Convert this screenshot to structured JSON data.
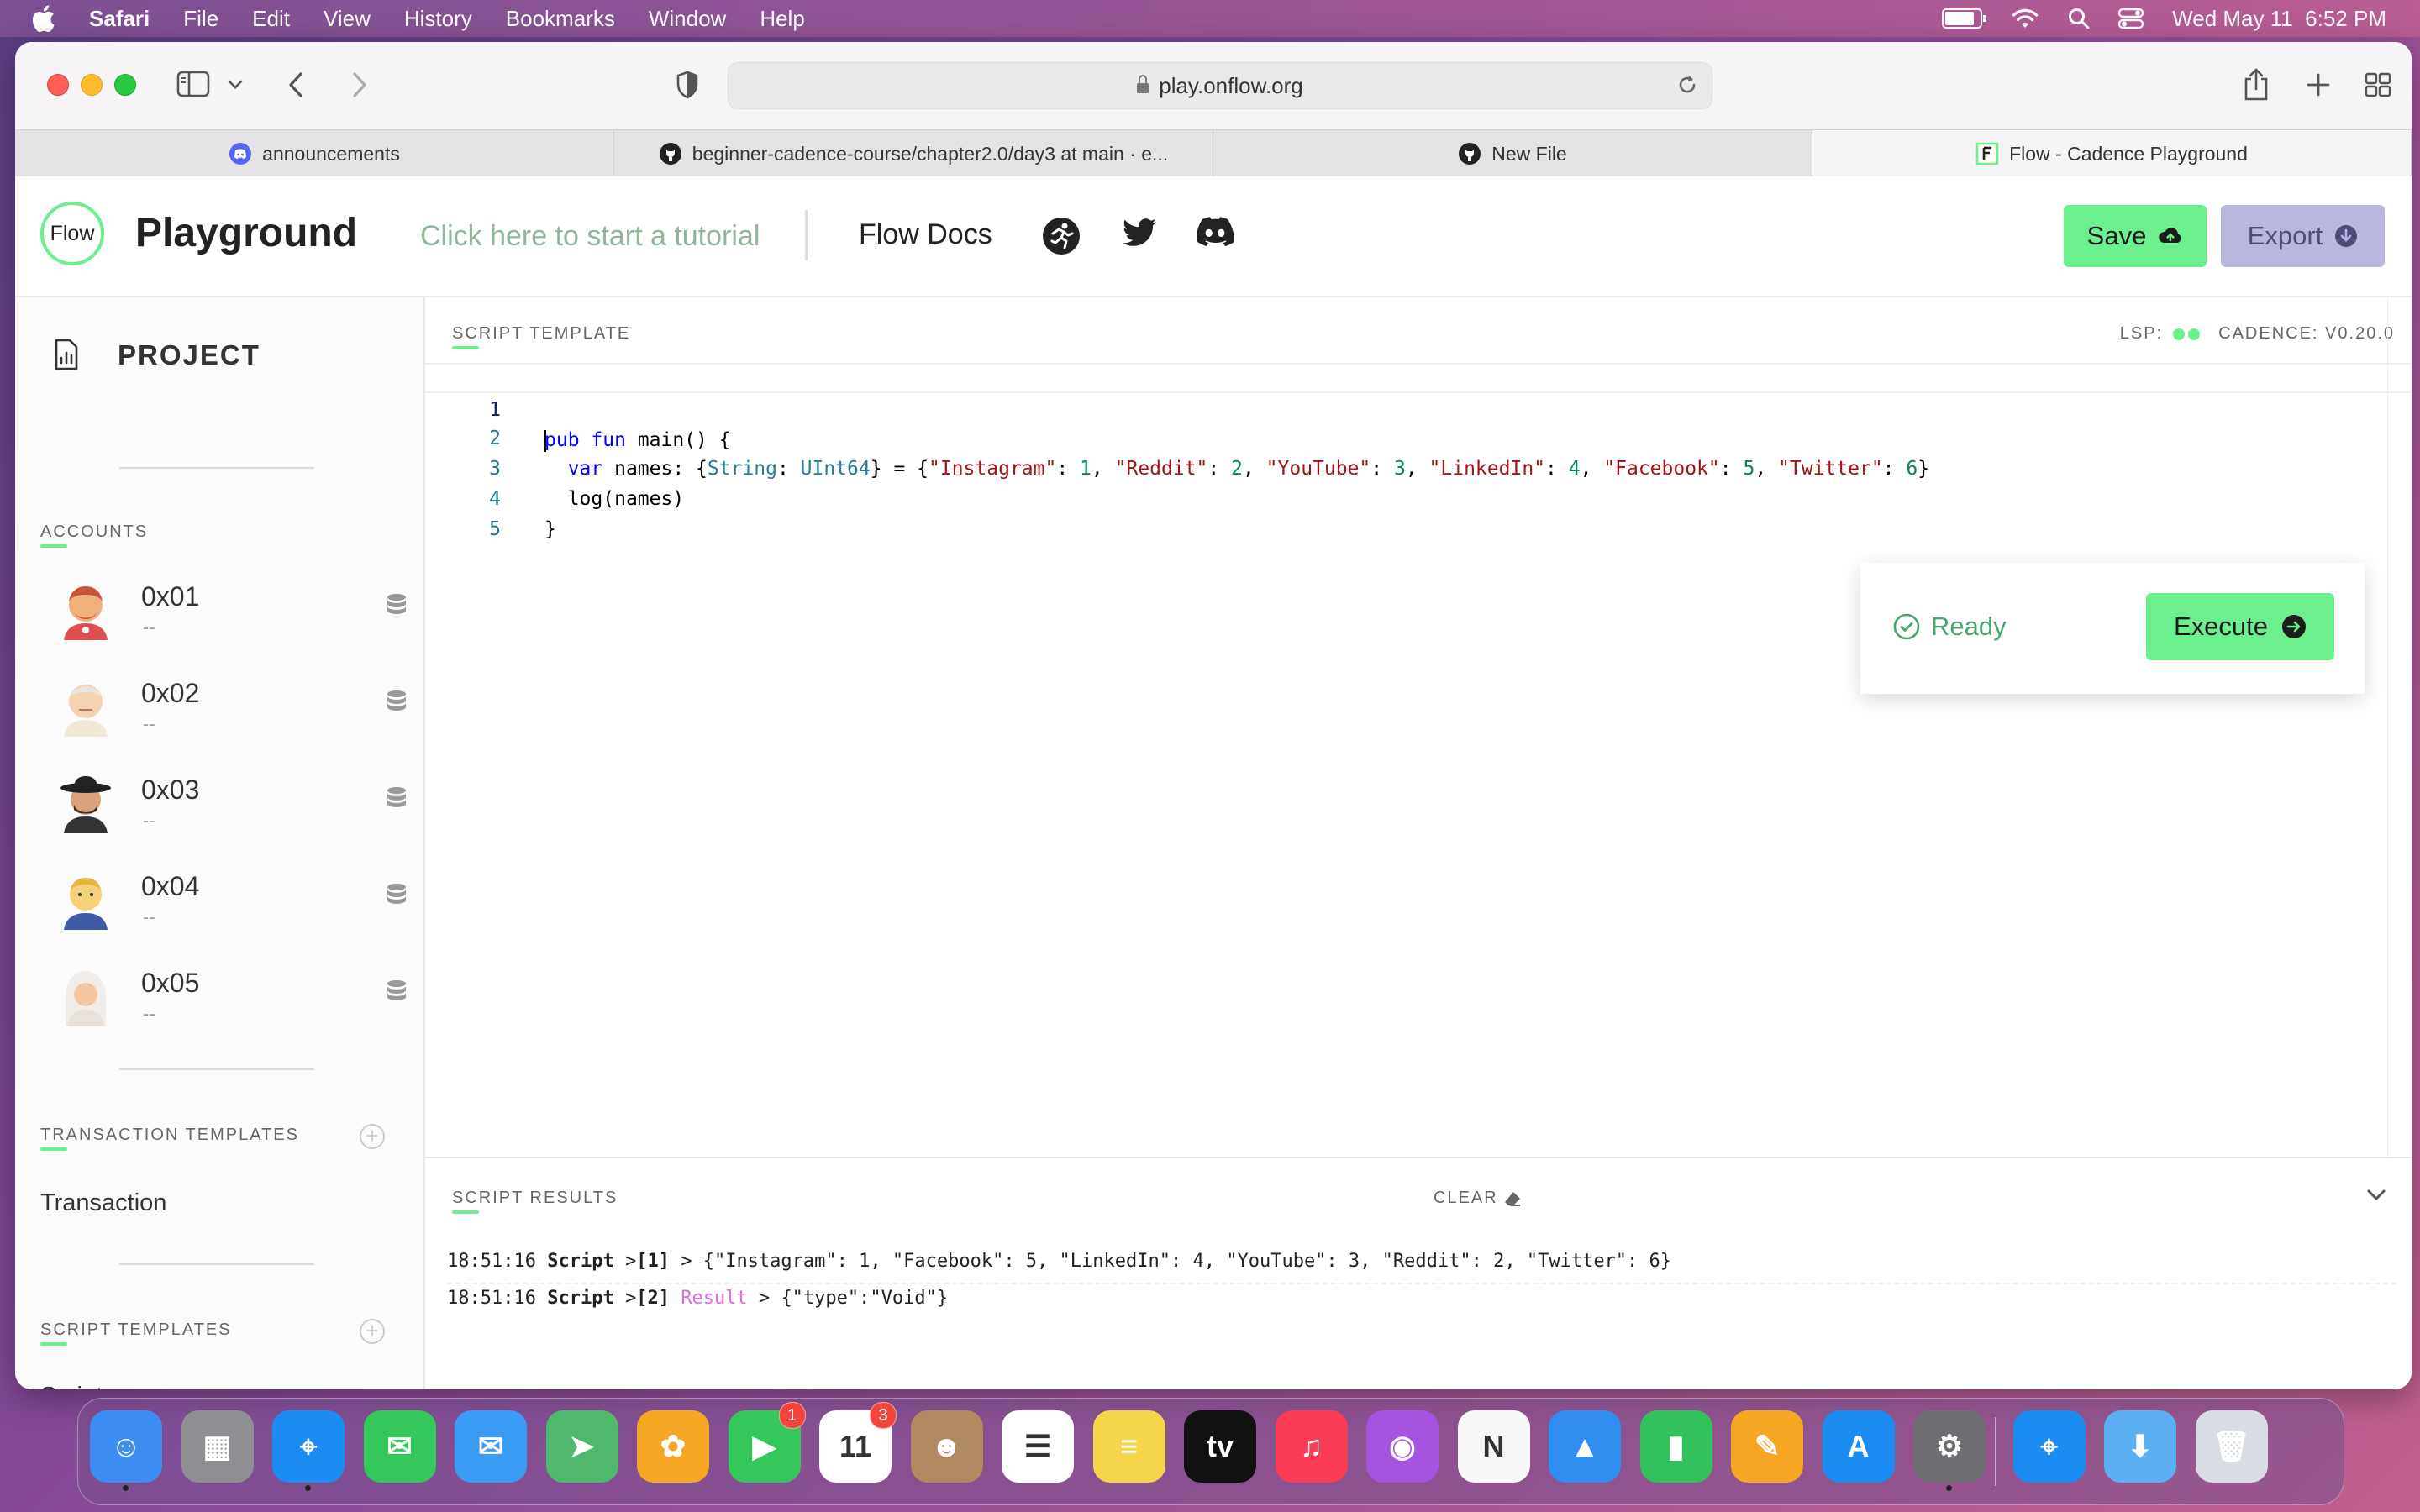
{
  "menubar": {
    "app_name": "Safari",
    "items": [
      "File",
      "Edit",
      "View",
      "History",
      "Bookmarks",
      "Window",
      "Help"
    ],
    "battery_level": 0.9,
    "datetime": "Wed May 11  6:52 PM"
  },
  "browser": {
    "url": "play.onflow.org",
    "tabs": [
      {
        "label": "announcements",
        "icon": "discord-icon",
        "active": false
      },
      {
        "label": "beginner-cadence-course/chapter2.0/day3 at main · e...",
        "icon": "github-icon",
        "active": false
      },
      {
        "label": "New File",
        "icon": "github-icon",
        "active": false
      },
      {
        "label": "Flow - Cadence Playground",
        "icon": "flow-favicon",
        "active": true
      }
    ]
  },
  "header": {
    "logo_text": "Flow",
    "title": "Playground",
    "tutorial_link": "Click here to start a tutorial",
    "docs_link": "Flow Docs",
    "social_icons": [
      "runner-icon",
      "twitter-icon",
      "discord-icon"
    ],
    "save_label": "Save",
    "export_label": "Export"
  },
  "sidebar": {
    "project_label": "PROJECT",
    "accounts_label": "ACCOUNTS",
    "accounts": [
      {
        "address": "0x01",
        "sub": "--"
      },
      {
        "address": "0x02",
        "sub": "--"
      },
      {
        "address": "0x03",
        "sub": "--"
      },
      {
        "address": "0x04",
        "sub": "--"
      },
      {
        "address": "0x05",
        "sub": "--"
      }
    ],
    "transaction_templates_label": "TRANSACTION TEMPLATES",
    "transaction_item": "Transaction",
    "script_templates_label": "SCRIPT TEMPLATES",
    "script_item": "Script"
  },
  "editor": {
    "label": "SCRIPT TEMPLATE",
    "lsp_label": "LSP:",
    "cadence_version": "CADENCE: V0.20.0",
    "line_numbers": [
      "1",
      "2",
      "3",
      "4",
      "5"
    ],
    "code": {
      "l1_kw1": "pub",
      "l1_kw2": "fun",
      "l1_rest": " main() {",
      "l2_kw": "var",
      "l2_names": " names: {",
      "l2_type1": "String",
      "l2_colon": ": ",
      "l2_type2": "UInt64",
      "l2_eq": "} = {",
      "pairs": [
        {
          "key": "\"Instagram\"",
          "val": "1"
        },
        {
          "key": "\"Reddit\"",
          "val": "2"
        },
        {
          "key": "\"YouTube\"",
          "val": "3"
        },
        {
          "key": "\"LinkedIn\"",
          "val": "4"
        },
        {
          "key": "\"Facebook\"",
          "val": "5"
        },
        {
          "key": "\"Twitter\"",
          "val": "6"
        }
      ],
      "l2_end": "}",
      "l3": "log(names)",
      "l4": "}"
    },
    "status": "Ready",
    "execute_label": "Execute"
  },
  "results": {
    "label": "SCRIPT RESULTS",
    "clear_label": "CLEAR",
    "lines": [
      {
        "time": "18:51:16",
        "kind": "Script",
        "index": "[1]",
        "tag": "",
        "text": "{\"Instagram\": 1, \"Facebook\": 5, \"LinkedIn\": 4, \"YouTube\": 3, \"Reddit\": 2, \"Twitter\": 6}"
      },
      {
        "time": "18:51:16",
        "kind": "Script",
        "index": "[2]",
        "tag": "Result",
        "text": "{\"type\":\"Void\"}"
      }
    ]
  },
  "dock": {
    "items": [
      {
        "name": "finder-icon",
        "color": "#3d8df5",
        "glyph": "☺",
        "running": true
      },
      {
        "name": "launchpad-icon",
        "color": "#8e8e93",
        "glyph": "▦",
        "running": false
      },
      {
        "name": "safari-icon",
        "color": "#1b8cf2",
        "glyph": "⌖",
        "running": true
      },
      {
        "name": "messages-icon",
        "color": "#34c759",
        "glyph": "✉",
        "running": false
      },
      {
        "name": "mail-icon",
        "color": "#3b9cf5",
        "glyph": "✉",
        "running": false
      },
      {
        "name": "maps-icon",
        "color": "#4fb86b",
        "glyph": "➤",
        "running": false
      },
      {
        "name": "photos-icon",
        "color": "#f5a623",
        "glyph": "✿",
        "running": false
      },
      {
        "name": "facetime-icon",
        "color": "#34c759",
        "glyph": "▶",
        "running": false,
        "badge": "1"
      },
      {
        "name": "calendar-icon",
        "color": "#ffffff",
        "glyph": "11",
        "running": false,
        "badge": "3",
        "dark": true
      },
      {
        "name": "contacts-icon",
        "color": "#b08a5e",
        "glyph": "☻",
        "running": false
      },
      {
        "name": "reminders-icon",
        "color": "#ffffff",
        "glyph": "☰",
        "running": false,
        "dark": true
      },
      {
        "name": "notes-icon",
        "color": "#f7d54a",
        "glyph": "≡",
        "running": false
      },
      {
        "name": "apple-tv-icon",
        "color": "#111111",
        "glyph": "tv",
        "running": false
      },
      {
        "name": "music-icon",
        "color": "#fa3c55",
        "glyph": "♫",
        "running": false
      },
      {
        "name": "podcasts-icon",
        "color": "#a653e0",
        "glyph": "◉",
        "running": false
      },
      {
        "name": "news-icon",
        "color": "#f8f8f8",
        "glyph": "N",
        "running": false,
        "dark": true
      },
      {
        "name": "keynote-icon",
        "color": "#2f8ef0",
        "glyph": "▲",
        "running": false
      },
      {
        "name": "numbers-icon",
        "color": "#32c15a",
        "glyph": "▮",
        "running": false
      },
      {
        "name": "pages-icon",
        "color": "#f5a623",
        "glyph": "✎",
        "running": false
      },
      {
        "name": "app-store-icon",
        "color": "#1b8cf2",
        "glyph": "A",
        "running": false
      },
      {
        "name": "system-preferences-icon",
        "color": "#6e6e73",
        "glyph": "⚙",
        "running": true
      },
      {
        "name": "safari-preview-icon",
        "color": "#1b8cf2",
        "glyph": "⌖",
        "running": false
      },
      {
        "name": "downloads-folder-icon",
        "color": "#5ab0f0",
        "glyph": "⬇",
        "running": false
      },
      {
        "name": "trash-icon",
        "color": "#d8dde3",
        "glyph": "🗑",
        "running": false
      }
    ]
  }
}
